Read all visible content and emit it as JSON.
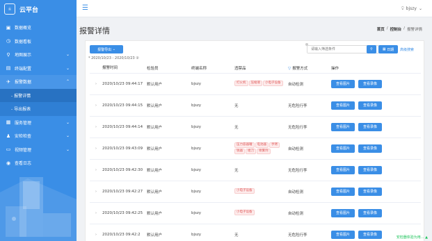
{
  "sidebar": {
    "brand": "云平台",
    "brand_logo_text": "云",
    "menu": [
      {
        "label": "数据概览",
        "icon": "dashboard-icon",
        "glyph": "▣",
        "arrow": ""
      },
      {
        "label": "数据看板",
        "icon": "chart-board-icon",
        "glyph": "◷",
        "arrow": ""
      },
      {
        "label": "地图展示",
        "icon": "map-icon",
        "glyph": "⚲",
        "arrow": "⌄"
      },
      {
        "label": "终端配置",
        "icon": "terminal-icon",
        "glyph": "▤",
        "arrow": "⌄"
      },
      {
        "label": "报警数据",
        "icon": "alarm-icon",
        "glyph": "✈",
        "arrow": "⌃"
      }
    ],
    "submenu": [
      {
        "label": "- 报警详情"
      },
      {
        "label": "- 导出报表"
      }
    ],
    "menu2": [
      {
        "label": "服务管理",
        "icon": "service-icon",
        "glyph": "▦",
        "arrow": "⌄"
      },
      {
        "label": "安检检查",
        "icon": "user-check-icon",
        "glyph": "♟",
        "arrow": "⌄"
      },
      {
        "label": "视频管理",
        "icon": "video-icon",
        "glyph": "▭",
        "arrow": "⌄"
      },
      {
        "label": "查看日志",
        "icon": "log-icon",
        "glyph": "◉",
        "arrow": ""
      }
    ]
  },
  "topbar": {
    "menu_glyph": "☰",
    "user_glyph": "⍜",
    "user": "bjszy",
    "user_arrow": "⌄"
  },
  "page": {
    "title": "报警详情",
    "breadcrumb": [
      "首页",
      "/",
      "控制台",
      "/",
      "报警详情"
    ]
  },
  "toolbar": {
    "export_label": "报警导出",
    "export_arrow": "⌄",
    "daterange": "* 2020/10/23 - 2020/10/23",
    "daterange_icon": "②",
    "search_placeholder": "请输入筛选条件",
    "search_glyph": "⚲",
    "date_label": "日期",
    "date_glyph": "▦",
    "advanced_label": "高级搜索"
  },
  "table": {
    "headers": {
      "time": "报警时间",
      "user": "检验员",
      "terminal": "终端名称",
      "items": "违禁品",
      "mode": "报警方式",
      "mode_glyph": "▽",
      "ops": "操作"
    },
    "expand_glyph": "›",
    "rows": [
      {
        "time": "2020/10/23 09:44:17",
        "user": "默认用户",
        "terminal": "bjszy",
        "items": [
          "打火机",
          "压缩液",
          "小电子设备"
        ],
        "items_text": "",
        "mode": "自动检测"
      },
      {
        "time": "2020/10/23 09:44:15",
        "user": "默认用户",
        "terminal": "bjszy",
        "items": [],
        "items_text": "无",
        "mode": "无危险行李"
      },
      {
        "time": "2020/10/23 09:44:14",
        "user": "默认用户",
        "terminal": "bjszy",
        "items": [],
        "items_text": "无",
        "mode": "无危险行李"
      },
      {
        "time": "2020/10/23 09:43:09",
        "user": "默认用户",
        "terminal": "bjszy",
        "items": [
          "压力容器罐",
          "电池器",
          "手铐",
          "锐器",
          "组刀",
          "喷雾剂"
        ],
        "items_text": "",
        "mode": "自动检测"
      },
      {
        "time": "2020/10/23 09:42:30",
        "user": "默认用户",
        "terminal": "bjszy",
        "items": [],
        "items_text": "无",
        "mode": "无危险行李"
      },
      {
        "time": "2020/10/23 09:42:27",
        "user": "默认用户",
        "terminal": "bjszy",
        "items": [
          "小电子设备"
        ],
        "items_text": "",
        "mode": "自动检测"
      },
      {
        "time": "2020/10/23 09:42:25",
        "user": "默认用户",
        "terminal": "bjszy",
        "items": [
          "小电子设备"
        ],
        "items_text": "",
        "mode": "自动检测"
      },
      {
        "time": "2020/10/23 09:42:2",
        "user": "默认用户",
        "terminal": "bjszy",
        "items": [],
        "items_text": "无",
        "mode": "无危险行李"
      }
    ],
    "op_image": "查看图片",
    "op_video": "查看录像"
  },
  "watermark": "安检器体验为用... ▲"
}
